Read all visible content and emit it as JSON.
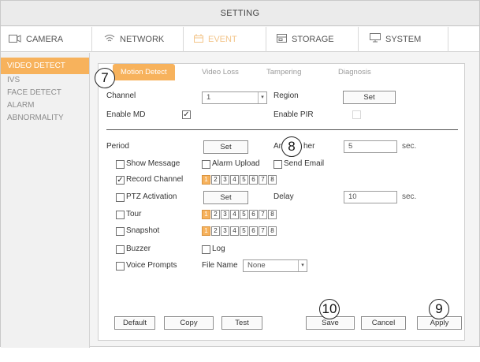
{
  "window": {
    "title": "SETTING"
  },
  "main_tabs": [
    {
      "label": "CAMERA",
      "icon": "camera-icon"
    },
    {
      "label": "NETWORK",
      "icon": "network-icon"
    },
    {
      "label": "EVENT",
      "icon": "event-icon",
      "active": true
    },
    {
      "label": "STORAGE",
      "icon": "storage-icon"
    },
    {
      "label": "SYSTEM",
      "icon": "system-icon"
    }
  ],
  "sidebar": {
    "items": [
      {
        "label": "VIDEO DETECT",
        "active": true
      },
      {
        "label": "IVS"
      },
      {
        "label": "FACE DETECT"
      },
      {
        "label": "ALARM"
      },
      {
        "label": "ABNORMALITY"
      }
    ]
  },
  "sub_tabs": [
    {
      "label": "Motion Detect",
      "active": true
    },
    {
      "label": "Video Loss"
    },
    {
      "label": "Tampering"
    },
    {
      "label": "Diagnosis"
    }
  ],
  "form": {
    "channel_label": "Channel",
    "channel_value": "1",
    "region_label": "Region",
    "region_button": "Set",
    "enable_md_label": "Enable MD",
    "enable_md_checked": "✓",
    "enable_pir_label": "Enable PIR",
    "period_label": "Period",
    "period_button": "Set",
    "anti_dither_label_start": "An",
    "anti_dither_label_end": "her",
    "anti_dither_value": "5",
    "anti_dither_unit": "sec.",
    "show_message_label": "Show Message",
    "alarm_upload_label": "Alarm Upload",
    "send_email_label": "Send Email",
    "record_channel_label": "Record Channel",
    "record_channel_checked": "✓",
    "ptz_activation_label": "PTZ Activation",
    "ptz_button": "Set",
    "delay_label": "Delay",
    "delay_value": "10",
    "delay_unit": "sec.",
    "tour_label": "Tour",
    "snapshot_label": "Snapshot",
    "buzzer_label": "Buzzer",
    "log_label": "Log",
    "voice_prompts_label": "Voice Prompts",
    "file_name_label": "File Name",
    "file_name_value": "None",
    "channel_numbers": [
      "1",
      "2",
      "3",
      "4",
      "5",
      "6",
      "7",
      "8"
    ]
  },
  "buttons": {
    "default": "Default",
    "copy": "Copy",
    "test": "Test",
    "save": "Save",
    "cancel": "Cancel",
    "apply": "Apply"
  },
  "callouts": {
    "c7": "7",
    "c8": "8",
    "c9": "9",
    "c10": "10"
  },
  "colors": {
    "accent": "#f7b25c",
    "accent_text": "#f3c58a"
  }
}
